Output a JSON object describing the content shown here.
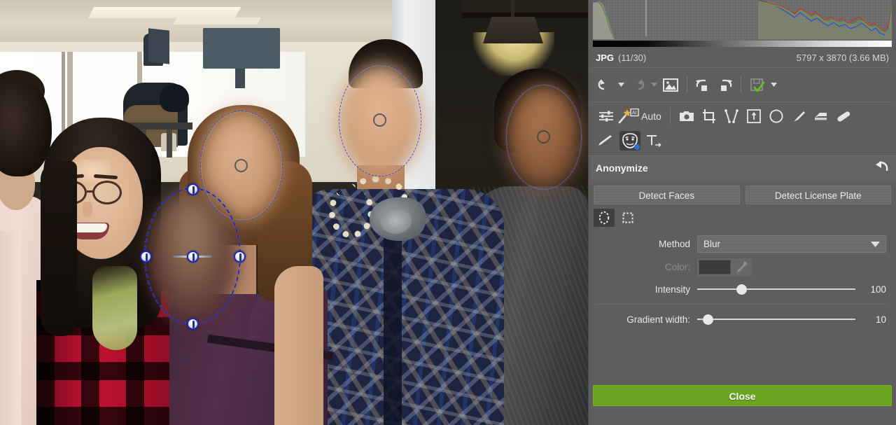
{
  "image_info": {
    "format": "JPG",
    "counter": "(11/30)",
    "dimensions": "5797 x 3870 (3.66 MB)"
  },
  "histogram": {
    "type": "rgb-histogram",
    "gradient_bar": true
  },
  "edit_toolbar": {
    "undo_icon": "undo-icon",
    "undo_caret_icon": "chevron-down-icon",
    "redo_icon": "redo-icon",
    "redo_caret_icon": "chevron-down-icon",
    "image_icon": "picture-icon",
    "rotate_left_icon": "rotate-left-icon",
    "rotate_right_icon": "rotate-right-icon",
    "save_icon": "save-check-icon",
    "save_caret_icon": "chevron-down-icon"
  },
  "tools": {
    "sliders_icon": "adjustments-sliders-icon",
    "magic_icon": "magic-wand-ai-icon",
    "auto_label": "Auto",
    "items": [
      {
        "icon": "camera-icon",
        "name": "camera-tool",
        "active": false
      },
      {
        "icon": "crop-icon",
        "name": "crop-tool",
        "active": false
      },
      {
        "icon": "perspective-icon",
        "name": "perspective-tool",
        "active": false
      },
      {
        "icon": "resize-icon",
        "name": "resize-tool",
        "active": false
      },
      {
        "icon": "ellipse-icon",
        "name": "ellipse-tool",
        "active": false
      },
      {
        "icon": "brush-icon",
        "name": "brush-tool",
        "active": false
      },
      {
        "icon": "eraser-icon",
        "name": "eraser-tool",
        "active": false
      },
      {
        "icon": "bandage-icon",
        "name": "healing-tool",
        "active": false
      }
    ],
    "items2": [
      {
        "icon": "pen-icon",
        "name": "pen-tool",
        "active": false
      },
      {
        "icon": "anonymize-mask-icon",
        "name": "anonymize-tool",
        "active": true
      },
      {
        "icon": "text-icon",
        "name": "text-tool",
        "active": false
      }
    ]
  },
  "anonymize": {
    "title": "Anonymize",
    "reset_icon": "reset-arrow-icon",
    "detect_faces_label": "Detect Faces",
    "detect_license_plate_label": "Detect License Plate",
    "shape_tools": [
      {
        "name": "ellipse-shape",
        "icon": "dashed-ellipse-icon",
        "active": true
      },
      {
        "name": "rectangle-shape",
        "icon": "dashed-rectangle-icon",
        "active": false
      }
    ],
    "method_label": "Method",
    "method_value": "Blur",
    "method_caret_icon": "chevron-down-icon",
    "color_label": "Color:",
    "color_value": "#3b3b3b",
    "eyedropper_icon": "eyedropper-icon",
    "intensity_label": "Intensity",
    "intensity_value": "100",
    "intensity_percent": 28,
    "gradient_width_label": "Gradient width:",
    "gradient_width_value": "10",
    "gradient_width_percent": 7,
    "close_label": "Close"
  },
  "colors": {
    "panel_bg": "#5e5e5e",
    "accent_green": "#6aa420",
    "selection_blue": "#1b28c6",
    "histogram_red": "#cc3333",
    "histogram_green": "#55aa44",
    "histogram_blue": "#3b52cc"
  },
  "canvas": {
    "selections": [
      {
        "name": "face-selection-1",
        "selected": false
      },
      {
        "name": "face-selection-2",
        "selected": true
      },
      {
        "name": "face-selection-3",
        "selected": false
      },
      {
        "name": "face-selection-4",
        "selected": false
      }
    ]
  }
}
